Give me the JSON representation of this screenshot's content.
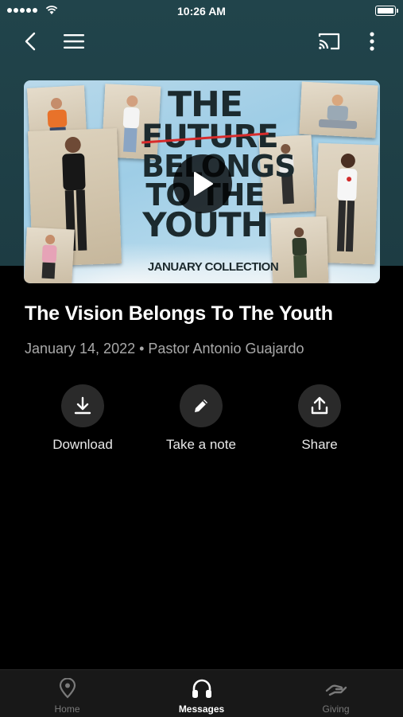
{
  "status_bar": {
    "time": "10:26 AM"
  },
  "hero": {
    "title_lines": [
      "THE",
      "FUTURE",
      "BELONGS",
      "TO THE",
      "YOUTH"
    ],
    "subtitle": "JANUARY COLLECTION",
    "script_word": "Future"
  },
  "message": {
    "title": "The Vision Belongs To The Youth",
    "meta": "January 14, 2022 • Pastor Antonio Guajardo"
  },
  "actions": [
    {
      "label": "Download",
      "icon": "download-icon"
    },
    {
      "label": "Take a note",
      "icon": "pencil-icon"
    },
    {
      "label": "Share",
      "icon": "share-icon"
    }
  ],
  "tabs": [
    {
      "label": "Home",
      "icon": "location-pin-icon",
      "active": false
    },
    {
      "label": "Messages",
      "icon": "headphones-icon",
      "active": true
    },
    {
      "label": "Giving",
      "icon": "giving-hand-icon",
      "active": false
    }
  ],
  "colors": {
    "header_bg": "#21444b",
    "background": "#000000",
    "inactive_tab": "#7a7a7a",
    "strike_red": "#d72b2b"
  }
}
